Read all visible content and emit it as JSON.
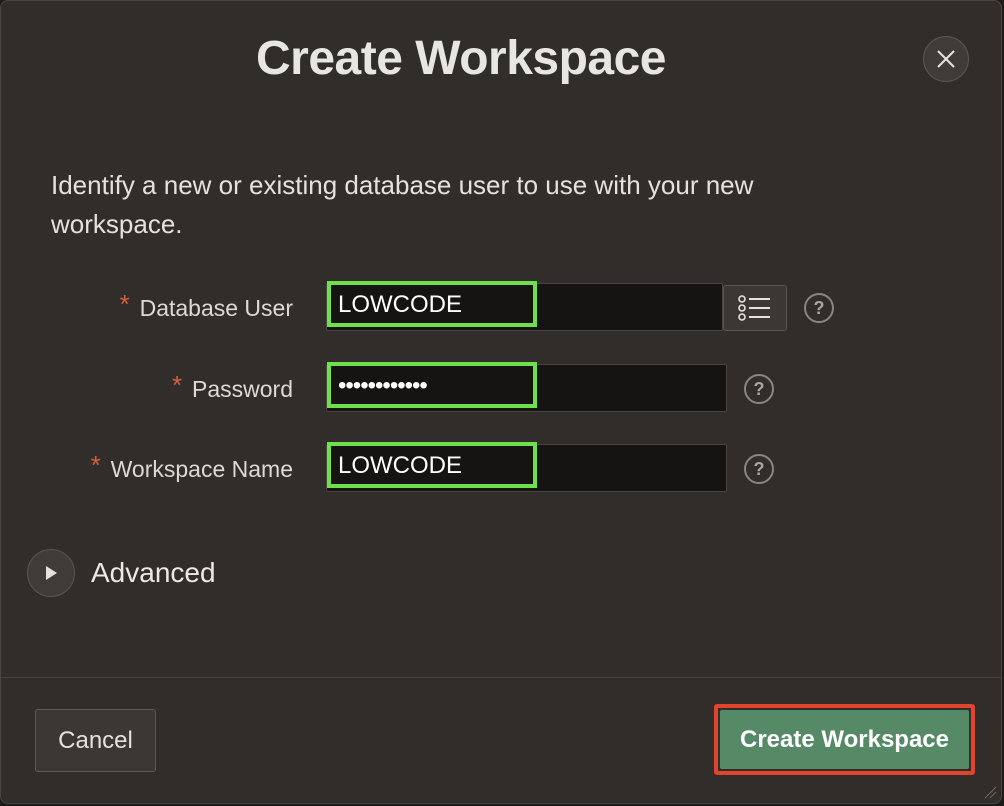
{
  "dialog": {
    "title": "Create Workspace",
    "close_icon": "close-icon",
    "intro": "Identify a new or existing database user to use with your new workspace."
  },
  "form": {
    "required_marker": "*",
    "database_user": {
      "label": "Database User",
      "value": "LOWCODE",
      "lov_icon": "list-icon",
      "help": "?"
    },
    "password": {
      "label": "Password",
      "value": "••••••••••••",
      "help": "?"
    },
    "workspace_name": {
      "label": "Workspace Name",
      "value": "LOWCODE",
      "help": "?"
    }
  },
  "advanced": {
    "label": "Advanced",
    "icon": "play-icon"
  },
  "footer": {
    "cancel_label": "Cancel",
    "create_label": "Create Workspace"
  },
  "colors": {
    "highlight_green": "#6ee14a",
    "highlight_red": "#e1432d",
    "primary_button": "#568a66",
    "required": "#d3613d"
  }
}
